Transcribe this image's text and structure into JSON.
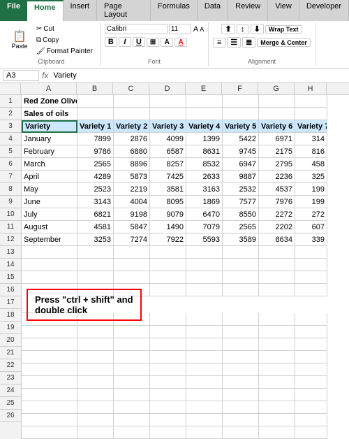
{
  "ribbon": {
    "tabs": [
      "File",
      "Home",
      "Insert",
      "Page Layout",
      "Formulas",
      "Data",
      "Review",
      "View",
      "Developer"
    ],
    "active_tab": "Home",
    "file_tab": "File",
    "groups": {
      "clipboard": {
        "label": "Clipboard",
        "paste": "Paste",
        "cut": "Cut",
        "copy": "Copy",
        "format_painter": "Format Painter"
      },
      "font": {
        "label": "Font",
        "font_name": "Calibri",
        "font_size": "11",
        "bold": "B",
        "italic": "I",
        "underline": "U"
      },
      "alignment": {
        "label": "Alignment",
        "wrap_text": "Wrap Text",
        "merge_center": "Merge & Center"
      }
    }
  },
  "formula_bar": {
    "cell_ref": "A3",
    "fx": "fx",
    "formula": "Variety"
  },
  "spreadsheet": {
    "col_headers": [
      "A",
      "B",
      "C",
      "D",
      "E",
      "F",
      "G",
      "H"
    ],
    "row_headers": [
      "1",
      "2",
      "3",
      "4",
      "5",
      "6",
      "7",
      "8",
      "9",
      "10",
      "11",
      "12",
      "13",
      "14",
      "15",
      "16",
      "17",
      "18",
      "19",
      "20",
      "21",
      "22",
      "23",
      "24",
      "25",
      "26"
    ],
    "rows": [
      [
        "Red Zone Olive Oil Company",
        "",
        "",
        "",
        "",
        "",
        "",
        ""
      ],
      [
        "Sales of oils",
        "",
        "",
        "",
        "",
        "",
        "",
        ""
      ],
      [
        "Variety",
        "Variety 1",
        "Variety 2",
        "Variety 3",
        "Variety 4",
        "Variety 5",
        "Variety 6",
        "Variety 7"
      ],
      [
        "January",
        "7899",
        "2876",
        "4099",
        "1399",
        "5422",
        "6971",
        "314"
      ],
      [
        "February",
        "9786",
        "6880",
        "6587",
        "8631",
        "9745",
        "2175",
        "816"
      ],
      [
        "March",
        "2565",
        "8896",
        "8257",
        "8532",
        "6947",
        "2795",
        "458"
      ],
      [
        "April",
        "4289",
        "5873",
        "7425",
        "2633",
        "9887",
        "2236",
        "325"
      ],
      [
        "May",
        "2523",
        "2219",
        "3581",
        "3163",
        "2532",
        "4537",
        "199"
      ],
      [
        "June",
        "3143",
        "4004",
        "8095",
        "1869",
        "7577",
        "7976",
        "199"
      ],
      [
        "July",
        "6821",
        "9198",
        "9079",
        "6470",
        "8550",
        "2272",
        "272"
      ],
      [
        "August",
        "4581",
        "5847",
        "1490",
        "7079",
        "2565",
        "2202",
        "607"
      ],
      [
        "September",
        "3253",
        "7274",
        "7922",
        "5593",
        "3589",
        "8634",
        "339"
      ],
      [
        "",
        "",
        "",
        "",
        "",
        "",
        "",
        ""
      ],
      [
        "",
        "",
        "",
        "",
        "",
        "",
        "",
        ""
      ],
      [
        "",
        "",
        "",
        "",
        "",
        "",
        "",
        ""
      ],
      [
        "",
        "",
        "",
        "",
        "",
        "",
        "",
        ""
      ],
      [
        "",
        "",
        "",
        "",
        "",
        "",
        "",
        ""
      ],
      [
        "",
        "",
        "",
        "",
        "",
        "",
        "",
        ""
      ],
      [
        "",
        "",
        "",
        "",
        "",
        "",
        "",
        ""
      ],
      [
        "",
        "",
        "",
        "",
        "",
        "",
        "",
        ""
      ],
      [
        "",
        "",
        "",
        "",
        "",
        "",
        "",
        ""
      ],
      [
        "",
        "",
        "",
        "",
        "",
        "",
        "",
        ""
      ],
      [
        "",
        "",
        "",
        "",
        "",
        "",
        "",
        ""
      ],
      [
        "",
        "",
        "",
        "",
        "",
        "",
        "",
        ""
      ],
      [
        "",
        "",
        "",
        "",
        "",
        "",
        "",
        ""
      ],
      [
        "",
        "",
        "",
        "",
        "",
        "",
        "",
        ""
      ]
    ]
  },
  "instruction": {
    "line1": "Press \"ctrl + shift\" and",
    "line2": "double click"
  }
}
